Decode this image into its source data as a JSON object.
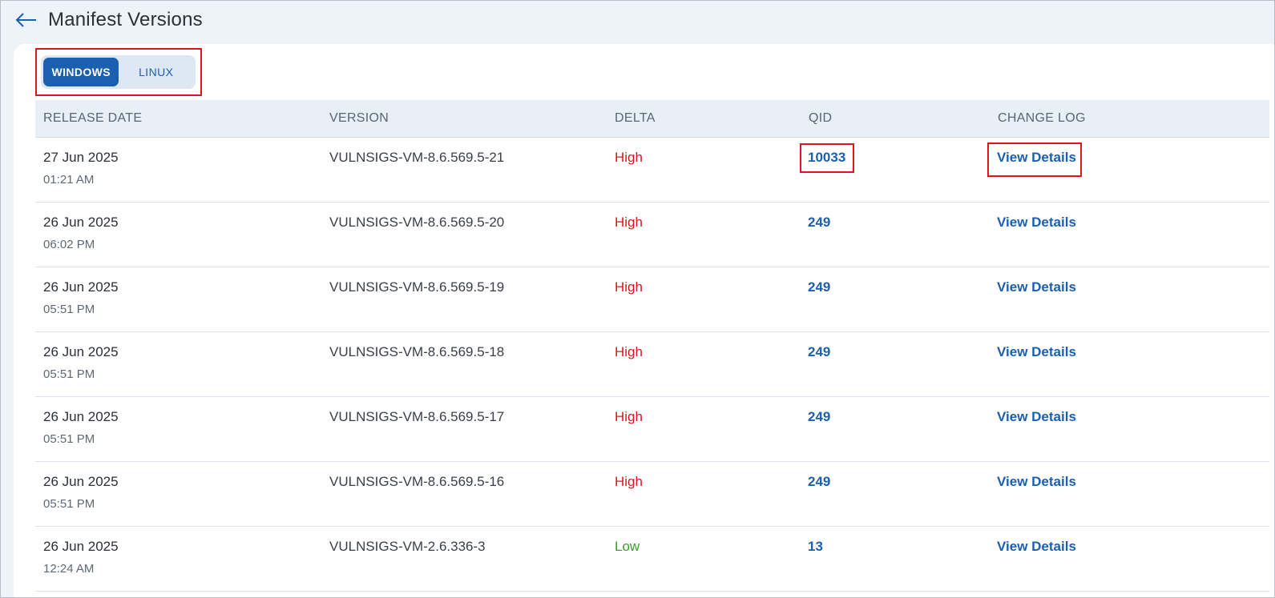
{
  "header": {
    "title": "Manifest Versions",
    "back_icon": "arrow-left-icon"
  },
  "os_toggle": {
    "options": [
      "WINDOWS",
      "LINUX"
    ],
    "selected": "WINDOWS"
  },
  "table": {
    "columns": [
      "RELEASE DATE",
      "VERSION",
      "DELTA",
      "QID",
      "CHANGE LOG"
    ],
    "rows": [
      {
        "date": "27 Jun 2025",
        "time": "01:21 AM",
        "version": "VULNSIGS-VM-8.6.569.5-21",
        "delta": "High",
        "qid": "10033",
        "change_log": "View Details"
      },
      {
        "date": "26 Jun 2025",
        "time": "06:02 PM",
        "version": "VULNSIGS-VM-8.6.569.5-20",
        "delta": "High",
        "qid": "249",
        "change_log": "View Details"
      },
      {
        "date": "26 Jun 2025",
        "time": "05:51 PM",
        "version": "VULNSIGS-VM-8.6.569.5-19",
        "delta": "High",
        "qid": "249",
        "change_log": "View Details"
      },
      {
        "date": "26 Jun 2025",
        "time": "05:51 PM",
        "version": "VULNSIGS-VM-8.6.569.5-18",
        "delta": "High",
        "qid": "249",
        "change_log": "View Details"
      },
      {
        "date": "26 Jun 2025",
        "time": "05:51 PM",
        "version": "VULNSIGS-VM-8.6.569.5-17",
        "delta": "High",
        "qid": "249",
        "change_log": "View Details"
      },
      {
        "date": "26 Jun 2025",
        "time": "05:51 PM",
        "version": "VULNSIGS-VM-8.6.569.5-16",
        "delta": "High",
        "qid": "249",
        "change_log": "View Details"
      },
      {
        "date": "26 Jun 2025",
        "time": "12:24 AM",
        "version": "VULNSIGS-VM-2.6.336-3",
        "delta": "Low",
        "qid": "13",
        "change_log": "View Details"
      }
    ]
  },
  "colors": {
    "accent": "#1b5fb0",
    "delta_high": "#e0141e",
    "delta_low": "#3c9a2e",
    "highlight_box": "#e0141e"
  }
}
